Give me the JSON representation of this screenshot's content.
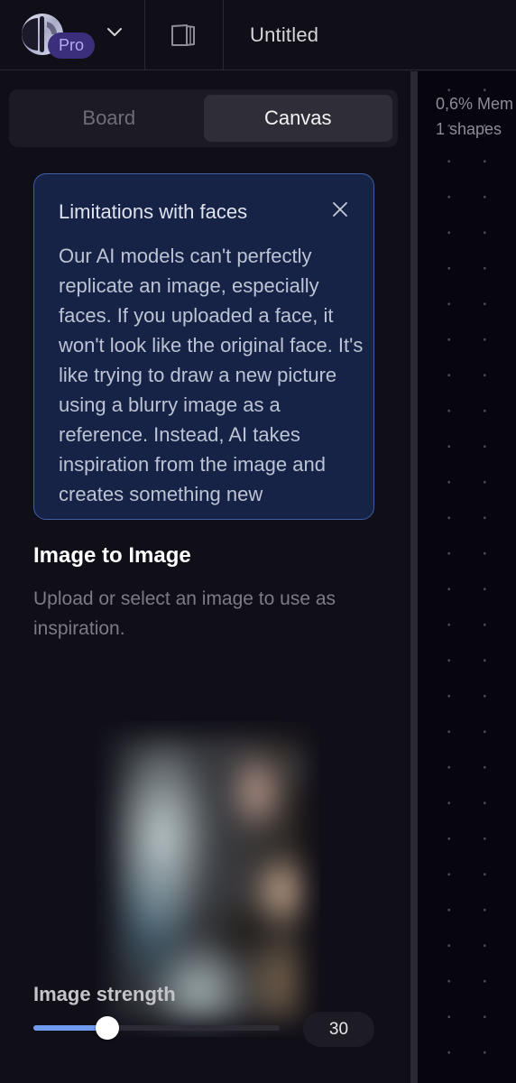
{
  "header": {
    "badge": "Pro",
    "doc_title": "Untitled"
  },
  "sidebar": {
    "tabs": [
      {
        "label": "Board",
        "active": false
      },
      {
        "label": "Canvas",
        "active": true
      }
    ],
    "notice": {
      "title": "Limitations with faces",
      "body": "Our AI models can't perfectly replicate an image, especially faces. If you uploaded a face, it won't look like the original face. It's like trying to draw a new picture using a blurry image as a reference. Instead, AI takes inspiration from the image and creates something new"
    },
    "image_to_image": {
      "title": "Image to Image",
      "description": "Upload or select an image to use as inspiration.",
      "strength_label": "Image strength",
      "strength_value": "30",
      "strength_fraction": 0.3
    }
  },
  "canvas": {
    "memory": "0,6% Mem",
    "shapes": "1 shapes"
  },
  "colors": {
    "accent": "#6f9bf0",
    "pro_badge": "#3b2f7c",
    "notice_bg": "#172346",
    "notice_border": "#3d5ea5"
  }
}
